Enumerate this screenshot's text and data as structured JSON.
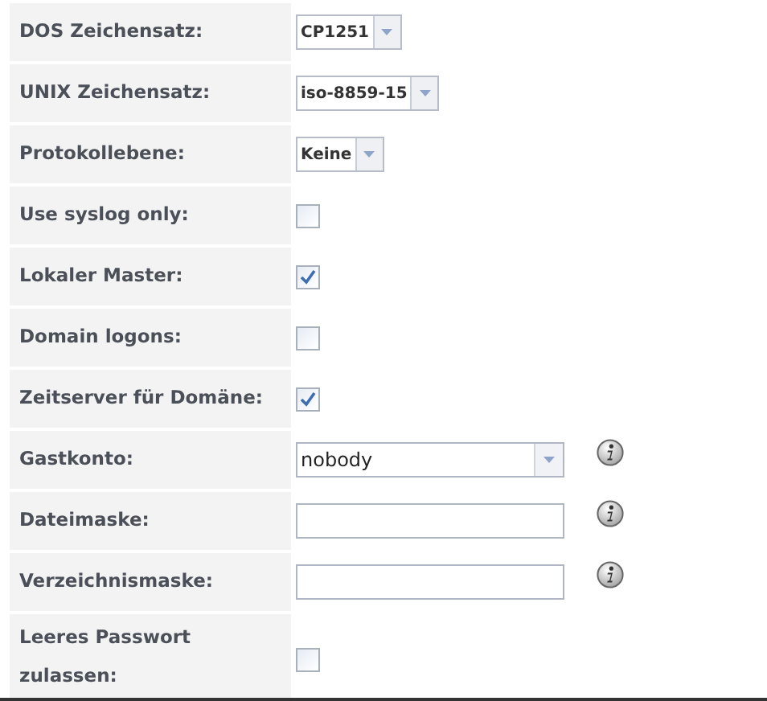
{
  "rows": [
    {
      "label": "DOS Zeichensatz:",
      "kind": "select",
      "value": "CP1251"
    },
    {
      "label": "UNIX Zeichensatz:",
      "kind": "select",
      "value": "iso-8859-15"
    },
    {
      "label": "Protokollebene:",
      "kind": "select",
      "value": "Keine"
    },
    {
      "label": "Use syslog only:",
      "kind": "checkbox",
      "checked": false
    },
    {
      "label": "Lokaler Master:",
      "kind": "checkbox",
      "checked": true
    },
    {
      "label": "Domain logons:",
      "kind": "checkbox",
      "checked": false
    },
    {
      "label": "Zeitserver für Domäne:",
      "kind": "checkbox",
      "checked": true
    },
    {
      "label": "Gastkonto:",
      "kind": "combo",
      "value": "nobody",
      "info": true
    },
    {
      "label": "Dateimaske:",
      "kind": "text",
      "info": true
    },
    {
      "label": "Verzeichnismaske:",
      "kind": "text",
      "info": true
    },
    {
      "label": "Leeres Passwort zulassen:",
      "kind": "checkbox",
      "checked": false
    }
  ]
}
